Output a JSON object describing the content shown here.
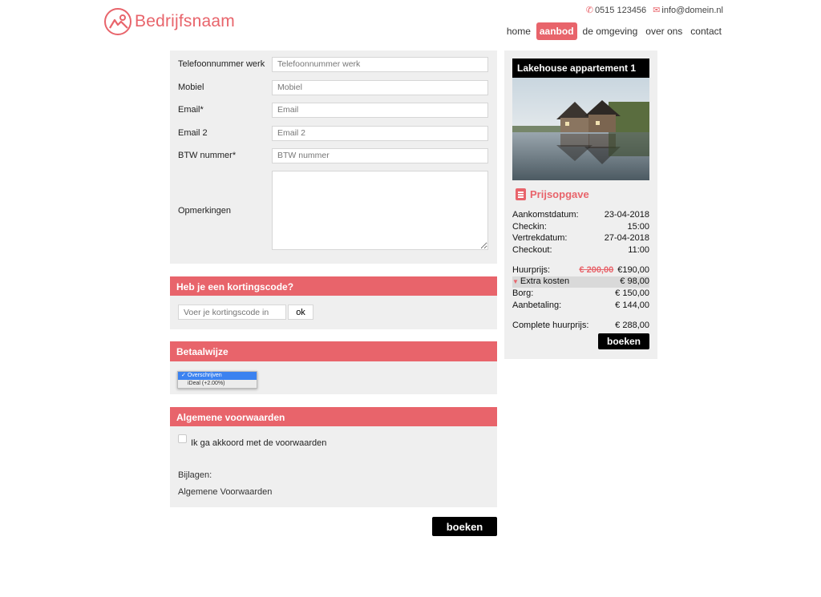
{
  "brand": {
    "name": "Bedrijfsnaam",
    "color": "#e8646b"
  },
  "contact": {
    "phone": "0515 123456",
    "email": "info@domein.nl"
  },
  "nav": [
    {
      "label": "home",
      "active": false
    },
    {
      "label": "aanbod",
      "active": true
    },
    {
      "label": "de omgeving",
      "active": false
    },
    {
      "label": "over ons",
      "active": false
    },
    {
      "label": "contact",
      "active": false
    }
  ],
  "form": {
    "fields": [
      {
        "label": "Telefoonnummer werk",
        "placeholder": "Telefoonnummer werk"
      },
      {
        "label": "Mobiel",
        "placeholder": "Mobiel"
      },
      {
        "label": "Email*",
        "placeholder": "Email"
      },
      {
        "label": "Email 2",
        "placeholder": "Email 2"
      },
      {
        "label": "BTW nummer*",
        "placeholder": "BTW nummer"
      }
    ],
    "remarks_label": "Opmerkingen"
  },
  "discount": {
    "heading": "Heb je een kortingscode?",
    "placeholder": "Voer je kortingscode in",
    "button": "ok"
  },
  "payment": {
    "heading": "Betaalwijze",
    "options": [
      "Overschrijven",
      "iDeal (+2.00%)"
    ],
    "selected": "Overschrijven"
  },
  "terms": {
    "heading": "Algemene voorwaarden",
    "agree": "Ik ga akkoord met de voorwaarden",
    "attachments_label": "Bijlagen:",
    "attachment": "Algemene Voorwaarden"
  },
  "book_button": "boeken",
  "summary": {
    "title": "Lakehouse appartement 1",
    "quote_heading": "Prijsopgave",
    "dates": [
      {
        "label": "Aankomstdatum:",
        "value": "23-04-2018"
      },
      {
        "label": "Checkin:",
        "value": "15:00"
      },
      {
        "label": "Vertrekdatum:",
        "value": "27-04-2018"
      },
      {
        "label": "Checkout:",
        "value": "11:00"
      }
    ],
    "rent_label": "Huurprijs:",
    "rent_old": "€ 200,00",
    "rent_new": "€190,00",
    "extra_label": "Extra kosten",
    "extra_value": "€ 98,00",
    "deposit_label": "Borg:",
    "deposit_value": "€ 150,00",
    "downpayment_label": "Aanbetaling:",
    "downpayment_value": "€ 144,00",
    "total_label": "Complete huurprijs:",
    "total_value": "€ 288,00",
    "book_button": "boeken"
  }
}
